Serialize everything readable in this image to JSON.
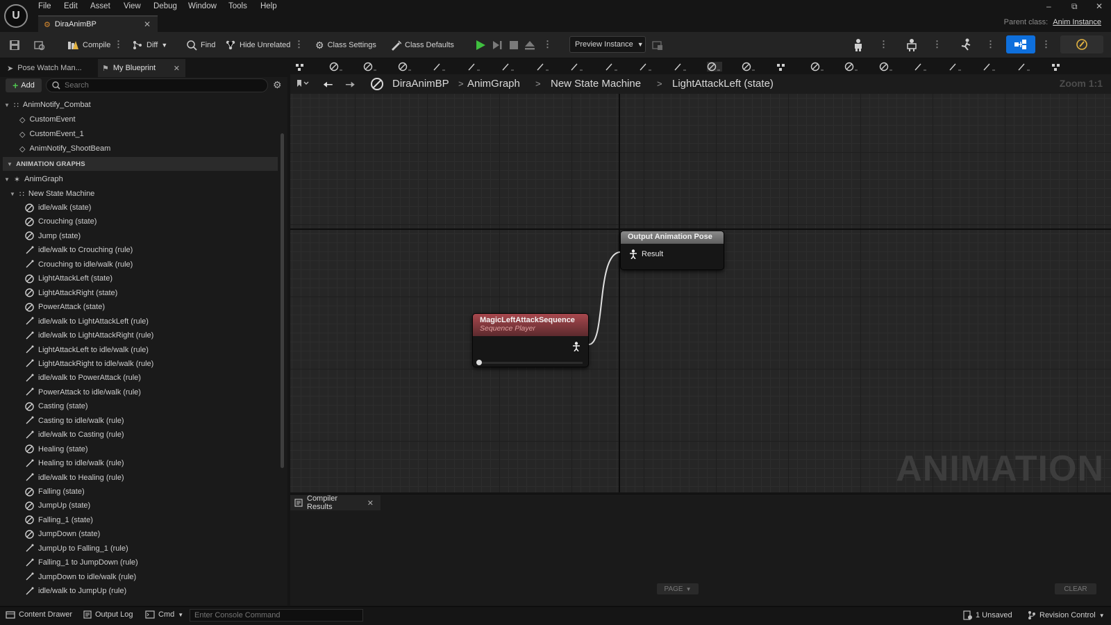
{
  "menu": {
    "items": [
      "File",
      "Edit",
      "Asset",
      "View",
      "Debug",
      "Window",
      "Tools",
      "Help"
    ]
  },
  "document_tab": {
    "title": "DiraAnimBP"
  },
  "parent_class": {
    "label": "Parent class:",
    "value": "Anim Instance"
  },
  "toolbar": {
    "compile": "Compile",
    "diff": "Diff",
    "find": "Find",
    "hide_unrelated": "Hide Unrelated",
    "class_settings": "Class Settings",
    "class_defaults": "Class Defaults",
    "preview_instance": "Preview Instance"
  },
  "left_tabs": {
    "pose_watch": "Pose Watch Man...",
    "my_blueprint": "My Blueprint"
  },
  "add_button": "Add",
  "search": {
    "placeholder": "Search"
  },
  "tree": {
    "anim_notify_group": "AnimNotify_Combat",
    "events": [
      "CustomEvent",
      "CustomEvent_1",
      "AnimNotify_ShootBeam"
    ],
    "section_header": "ANIMATION GRAPHS",
    "anim_graph": "AnimGraph",
    "state_machine": "New State Machine",
    "items": [
      {
        "label": "idle/walk (state)",
        "kind": "state"
      },
      {
        "label": "Crouching (state)",
        "kind": "state"
      },
      {
        "label": "Jump (state)",
        "kind": "state"
      },
      {
        "label": "idle/walk to Crouching (rule)",
        "kind": "rule"
      },
      {
        "label": "Crouching to idle/walk (rule)",
        "kind": "rule"
      },
      {
        "label": "LightAttackLeft (state)",
        "kind": "state"
      },
      {
        "label": "LightAttackRight (state)",
        "kind": "state"
      },
      {
        "label": "PowerAttack (state)",
        "kind": "state"
      },
      {
        "label": "idle/walk to LightAttackLeft (rule)",
        "kind": "rule"
      },
      {
        "label": "idle/walk to LightAttackRight (rule)",
        "kind": "rule"
      },
      {
        "label": "LightAttackLeft to idle/walk (rule)",
        "kind": "rule"
      },
      {
        "label": "LightAttackRight to idle/walk (rule)",
        "kind": "rule"
      },
      {
        "label": "idle/walk to PowerAttack (rule)",
        "kind": "rule"
      },
      {
        "label": "PowerAttack to idle/walk (rule)",
        "kind": "rule"
      },
      {
        "label": "Casting (state)",
        "kind": "state"
      },
      {
        "label": "Casting to idle/walk (rule)",
        "kind": "rule"
      },
      {
        "label": "idle/walk to Casting (rule)",
        "kind": "rule"
      },
      {
        "label": "Healing (state)",
        "kind": "state"
      },
      {
        "label": "Healing to idle/walk (rule)",
        "kind": "rule"
      },
      {
        "label": "idle/walk to Healing (rule)",
        "kind": "rule"
      },
      {
        "label": "Falling (state)",
        "kind": "state"
      },
      {
        "label": "JumpUp (state)",
        "kind": "state"
      },
      {
        "label": "Falling_1 (state)",
        "kind": "state"
      },
      {
        "label": "JumpDown (state)",
        "kind": "state"
      },
      {
        "label": "JumpUp to Falling_1 (rule)",
        "kind": "rule"
      },
      {
        "label": "Falling_1 to JumpDown (rule)",
        "kind": "rule"
      },
      {
        "label": "JumpDown to idle/walk (rule)",
        "kind": "rule"
      },
      {
        "label": "idle/walk to JumpUp (rule)",
        "kind": "rule"
      }
    ]
  },
  "breadcrumb": [
    "DiraAnimBP",
    "AnimGraph",
    "New State Machine",
    "LightAttackLeft (state)"
  ],
  "zoom": "Zoom 1:1",
  "graph": {
    "watermark": "ANIMATION",
    "output_node": {
      "title": "Output Animation Pose",
      "pin": "Result"
    },
    "sequence_node": {
      "title": "MagicLeftAttackSequence",
      "subtitle": "Sequence Player",
      "progress": 0
    }
  },
  "compiler_results": {
    "tab": "Compiler Results",
    "page_button": "PAGE",
    "clear_button": "CLEAR"
  },
  "statusbar": {
    "content_drawer": "Content Drawer",
    "output_log": "Output Log",
    "cmd": "Cmd",
    "console_placeholder": "Enter Console Command",
    "unsaved": "1 Unsaved",
    "revision_control": "Revision Control"
  },
  "colors": {
    "accent_blue": "#0e6fdc",
    "play_green": "#3fbf3f",
    "state_node_red": "#a8484e"
  }
}
